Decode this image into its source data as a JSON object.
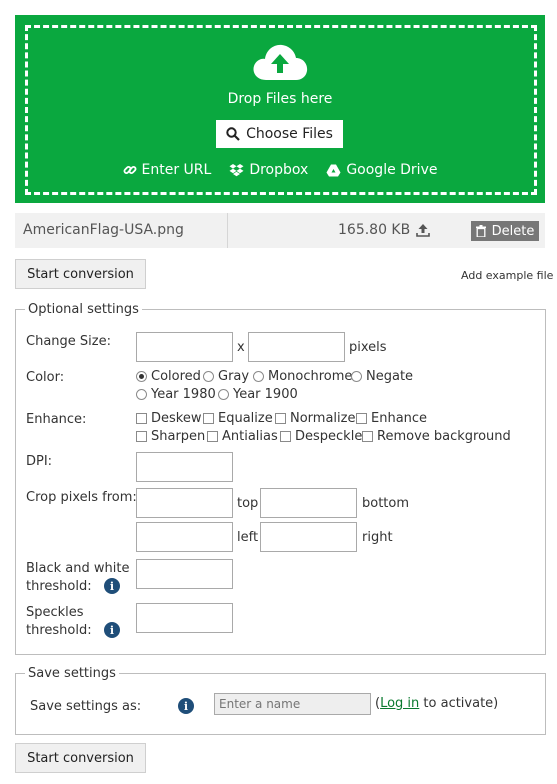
{
  "upload": {
    "drop_text": "Drop Files here",
    "choose_label": "Choose Files",
    "sources": [
      {
        "label": "Enter URL",
        "icon": "link-icon"
      },
      {
        "label": "Dropbox",
        "icon": "dropbox-icon"
      },
      {
        "label": "Google Drive",
        "icon": "google-drive-icon"
      }
    ],
    "accent_color": "#0aa83f"
  },
  "file": {
    "name": "AmericanFlag-USA.png",
    "size": "165.80 KB",
    "delete_label": "Delete"
  },
  "actions": {
    "start_label": "Start conversion",
    "add_example": "Add example file"
  },
  "optional": {
    "legend": "Optional settings",
    "change_size": {
      "label": "Change Size:",
      "x": "x",
      "unit": "pixels"
    },
    "color": {
      "label": "Color:",
      "options": [
        "Colored",
        "Gray",
        "Monochrome",
        "Negate",
        "Year 1980",
        "Year 1900"
      ],
      "selected": "Colored"
    },
    "enhance": {
      "label": "Enhance:",
      "options": [
        "Deskew",
        "Equalize",
        "Normalize",
        "Enhance",
        "Sharpen",
        "Antialias",
        "Despeckle",
        "Remove background"
      ]
    },
    "dpi": {
      "label": "DPI:"
    },
    "crop": {
      "label": "Crop pixels from:",
      "top": "top",
      "bottom": "bottom",
      "left": "left",
      "right": "right"
    },
    "bw_threshold": {
      "label_line1": "Black and white",
      "label_line2": "threshold:"
    },
    "speckles": {
      "label_line1": "Speckles",
      "label_line2": "threshold:"
    }
  },
  "save": {
    "legend": "Save settings",
    "label": "Save settings as:",
    "placeholder": "Enter a name",
    "note_open": "(",
    "login": "Log in",
    "note_rest": " to activate)"
  }
}
